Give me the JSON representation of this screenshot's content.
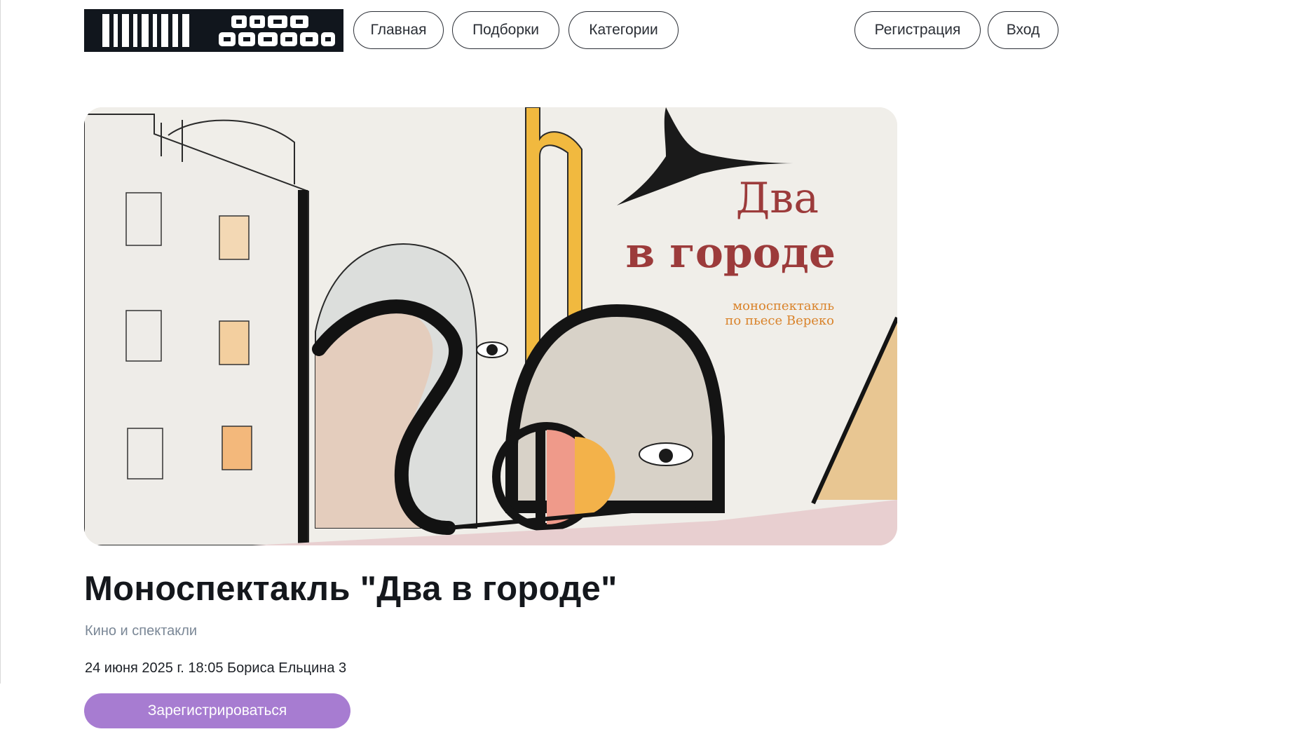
{
  "header": {
    "logo_alt": "ваша афиша",
    "nav": [
      {
        "label": "Главная"
      },
      {
        "label": "Подборки"
      },
      {
        "label": "Категории"
      }
    ],
    "auth": [
      {
        "label": "Регистрация"
      },
      {
        "label": "Вход"
      }
    ]
  },
  "poster": {
    "title_line1": "Два",
    "title_line2": "в городе",
    "subtitle_line1": "моноспектакль",
    "subtitle_line2": "по пьесе Вереко"
  },
  "event": {
    "title": "Моноспектакль \"Два в городе\"",
    "category": "Кино и спектакли",
    "datetime_location": "24 июня 2025 г. 18:05 Бориса Ельцина 3",
    "register_label": "Зарегистрироваться"
  },
  "colors": {
    "accent_button": "#a77cd1",
    "logo_bg": "#11161d",
    "poster_title": "#9c3b3b",
    "poster_subtitle": "#d9832b"
  }
}
